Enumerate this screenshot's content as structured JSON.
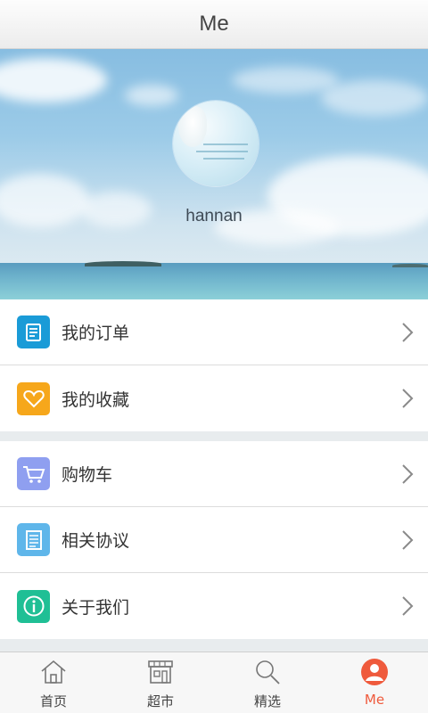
{
  "header": {
    "title": "Me"
  },
  "profile": {
    "username": "hannan"
  },
  "menu_group_1": [
    {
      "label": "我的订单",
      "icon": "order-list-icon",
      "color": "#1a9bd7"
    },
    {
      "label": "我的收藏",
      "icon": "heart-icon",
      "color": "#f6a71b"
    }
  ],
  "menu_group_2": [
    {
      "label": "购物车",
      "icon": "cart-icon",
      "color": "#8f9ff0"
    },
    {
      "label": "相关协议",
      "icon": "document-icon",
      "color": "#5fb6ea"
    },
    {
      "label": "关于我们",
      "icon": "info-icon",
      "color": "#1fbf95"
    }
  ],
  "tabbar": {
    "tabs": [
      {
        "label": "首页",
        "icon": "home-icon"
      },
      {
        "label": "超市",
        "icon": "store-icon"
      },
      {
        "label": "精选",
        "icon": "search-icon"
      },
      {
        "label": "Me",
        "icon": "user-icon",
        "active": true
      }
    ],
    "active_color": "#ef5a3c"
  }
}
